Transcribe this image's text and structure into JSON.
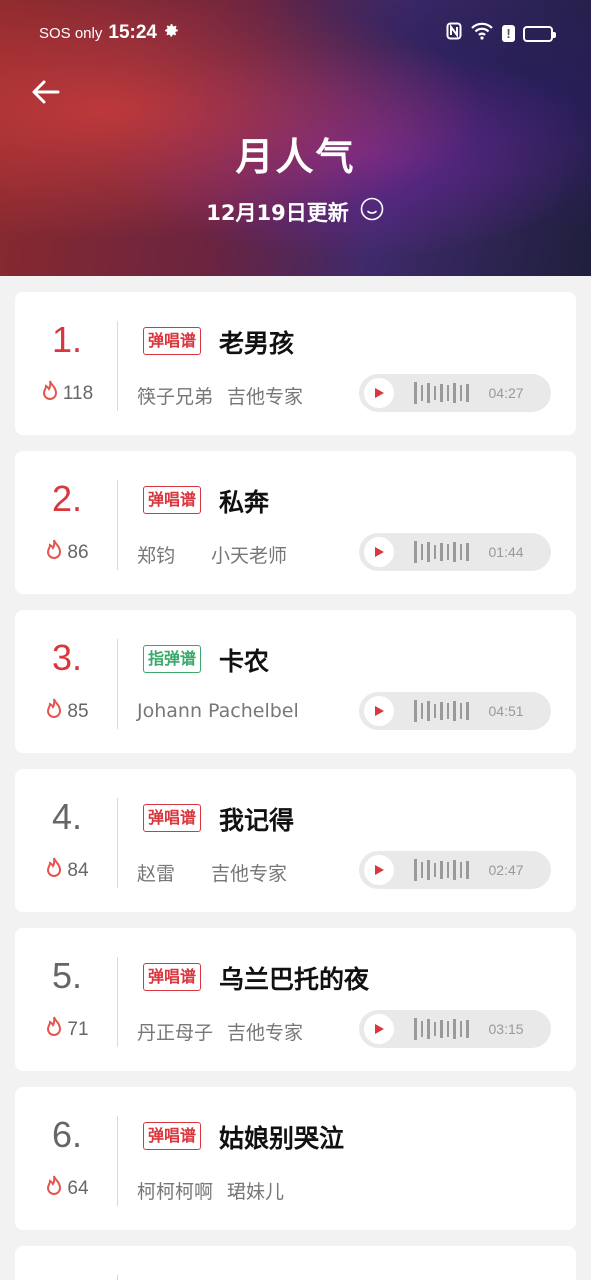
{
  "status_bar": {
    "carrier": "SOS only",
    "time": "15:24",
    "icons": [
      "gear-icon",
      "nfc-icon",
      "wifi-icon",
      "alert-icon",
      "battery-icon"
    ]
  },
  "header": {
    "title": "月人气",
    "update_text": "12月19日更新"
  },
  "colors": {
    "accent": "#d9363e",
    "green_tag": "#3aa86a"
  },
  "songs": [
    {
      "rank": "1.",
      "heat": "118",
      "tag": "弹唱谱",
      "title": "老男孩",
      "artist": "筷子兄弟",
      "arranger": "吉他专家",
      "duration": "04:27"
    },
    {
      "rank": "2.",
      "heat": "86",
      "tag": "弹唱谱",
      "title": "私奔",
      "artist": "郑钧",
      "arranger": "小天老师",
      "duration": "01:44"
    },
    {
      "rank": "3.",
      "heat": "85",
      "tag": "指弹谱",
      "title": "卡农",
      "artist": "Johann Pachelbel",
      "arranger": "",
      "duration": "04:51"
    },
    {
      "rank": "4.",
      "heat": "84",
      "tag": "弹唱谱",
      "title": "我记得",
      "artist": "赵雷",
      "arranger": "吉他专家",
      "duration": "02:47"
    },
    {
      "rank": "5.",
      "heat": "71",
      "tag": "弹唱谱",
      "title": "乌兰巴托的夜",
      "artist": "丹正母子",
      "arranger": "吉他专家",
      "duration": "03:15"
    },
    {
      "rank": "6.",
      "heat": "64",
      "tag": "弹唱谱",
      "title": "姑娘别哭泣",
      "artist": "柯柯柯啊",
      "arranger": "珺妹儿",
      "duration": ""
    }
  ]
}
